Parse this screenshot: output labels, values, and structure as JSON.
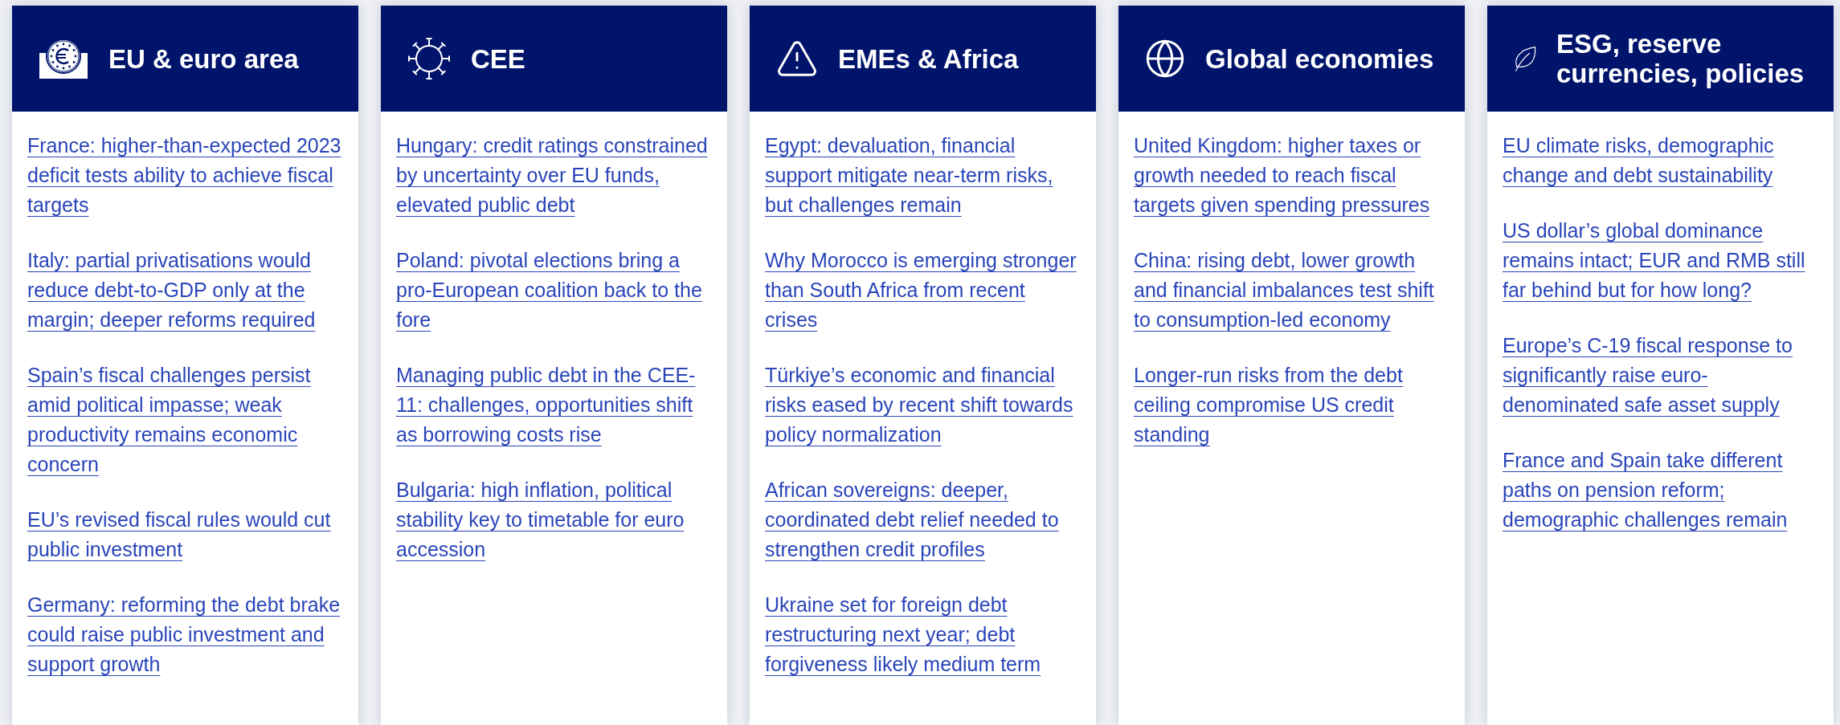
{
  "columns": [
    {
      "title": "EU & euro area",
      "links": [
        "France: higher-than-expected 2023 deficit tests ability to achieve fiscal targets",
        "Italy: partial privatisations would reduce debt-to-GDP only at the margin; deeper reforms required",
        "Spain’s fiscal challenges persist amid political impasse; weak productivity remains economic concern",
        "EU’s revised fiscal rules would cut public investment",
        "Germany: reforming the debt brake could raise public investment and support growth"
      ]
    },
    {
      "title": "CEE",
      "links": [
        "Hungary: credit ratings constrained by uncertainty over EU funds, elevated public debt",
        "Poland: pivotal elections bring a pro-European coalition back to the fore",
        "Managing public debt in the CEE-11: challenges, opportunities shift as borrowing costs rise",
        "Bulgaria: high inflation, political stability key to timetable for euro accession"
      ]
    },
    {
      "title": "EMEs & Africa",
      "links": [
        "Egypt: devaluation, financial support mitigate near-term risks, but challenges remain",
        "Why Morocco is emerging stronger than South Africa from recent crises",
        "Türkiye’s economic and financial risks eased by recent shift towards policy normalization",
        "African sovereigns: deeper, coordinated debt relief needed to strengthen credit profiles",
        "Ukraine set for foreign debt restructuring next year; debt forgiveness likely medium term"
      ]
    },
    {
      "title": "Global economies",
      "links": [
        "United Kingdom: higher taxes or growth needed to reach fiscal targets given spending pressures",
        "China: rising debt, lower growth and financial imbalances test shift to consumption-led economy",
        "Longer-run risks from the debt ceiling compromise US credit standing"
      ]
    },
    {
      "title": "ESG, reserve currencies, policies",
      "links": [
        "EU climate risks, demographic change and debt sustainability",
        "US dollar’s global dominance remains intact; EUR and RMB still far behind but for how long?",
        "Europe’s C-19 fiscal response to significantly raise euro-denominated safe asset supply",
        "France and Spain take different paths on pension reform; demographic challenges remain"
      ]
    }
  ]
}
